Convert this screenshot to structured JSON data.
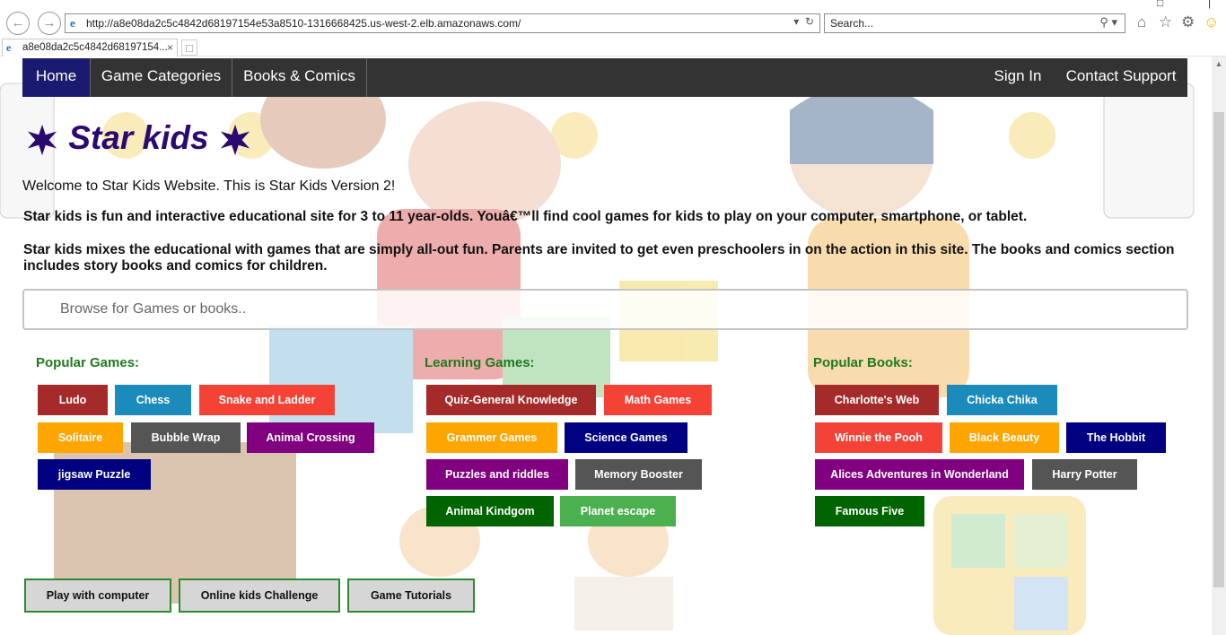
{
  "browser": {
    "url": "http://a8e08da2c5c4842d68197154e53a8510-1316668425.us-west-2.elb.amazonaws.com/",
    "search_placeholder": "Search...",
    "tab_title": "a8e08da2c5c4842d68197154..."
  },
  "nav": {
    "home": "Home",
    "categories": "Game Categories",
    "books": "Books & Comics",
    "sign_in": "Sign In",
    "contact": "Contact Support"
  },
  "hero": {
    "title": "Star kids",
    "welcome": "Welcome to Star Kids Website. This is Star Kids Version 2!",
    "intro": "Star kids is fun and interactive educational site for 3 to 11 year-olds. Youâ€™ll find cool games for kids to play on your computer, smartphone, or tablet.",
    "intro2": "Star kids mixes the educational with games that are simply all-out fun. Parents are invited to get even preschoolers in on the action in this site. The books and comics section includes story books and comics for children."
  },
  "search": {
    "placeholder": "Browse for Games or books.."
  },
  "popular_games": {
    "heading": "Popular Games:",
    "items": [
      {
        "label": "Ludo",
        "color": "#a52a2a"
      },
      {
        "label": "Chess",
        "color": "#1a8bbb"
      },
      {
        "label": "Snake and Ladder",
        "color": "#f44336"
      },
      {
        "label": "Solitaire",
        "color": "#ffa500"
      },
      {
        "label": "Bubble Wrap",
        "color": "#555555"
      },
      {
        "label": "Animal Crossing",
        "color": "#800080"
      },
      {
        "label": "jigsaw Puzzle",
        "color": "#000080"
      }
    ]
  },
  "learning_games": {
    "heading": "Learning Games:",
    "items": [
      {
        "label": "Quiz-General Knowledge",
        "color": "#a52a2a"
      },
      {
        "label": "Math Games",
        "color": "#f44336"
      },
      {
        "label": "Grammer Games",
        "color": "#ffa500"
      },
      {
        "label": "Science Games",
        "color": "#000080"
      },
      {
        "label": "Puzzles and riddles",
        "color": "#800080"
      },
      {
        "label": "Memory Booster",
        "color": "#555555"
      },
      {
        "label": "Animal Kindgom",
        "color": "#006400"
      },
      {
        "label": "Planet escape",
        "color": "#4caf50"
      }
    ]
  },
  "popular_books": {
    "heading": "Popular Books:",
    "items": [
      {
        "label": "Charlotte's Web",
        "color": "#a52a2a"
      },
      {
        "label": "Chicka Chika",
        "color": "#1a8bbb"
      },
      {
        "label": "Winnie the Pooh",
        "color": "#f44336"
      },
      {
        "label": "Black Beauty",
        "color": "#ffa500"
      },
      {
        "label": "The Hobbit",
        "color": "#000080"
      },
      {
        "label": "Alices Adventures in Wonderland",
        "color": "#800080"
      },
      {
        "label": "Harry Potter",
        "color": "#555555"
      },
      {
        "label": "Famous Five",
        "color": "#006400"
      }
    ]
  },
  "actions": {
    "play_computer": "Play with computer",
    "online_challenge": "Online kids Challenge",
    "tutorials": "Game Tutorials"
  },
  "icons": {
    "back": "back-arrow-icon",
    "forward": "forward-arrow-icon",
    "home": "home-icon",
    "favorites": "star-icon",
    "settings": "gear-icon",
    "feedback": "smiley-icon"
  }
}
